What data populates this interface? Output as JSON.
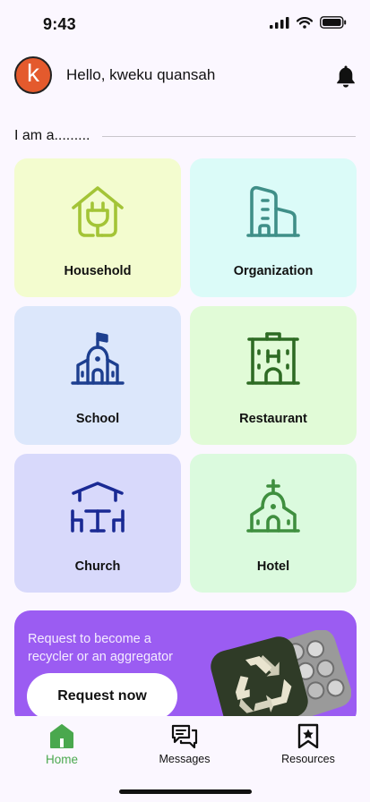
{
  "status_bar": {
    "time": "9:43"
  },
  "header": {
    "avatar_letter": "k",
    "greeting": "Hello, kweku quansah"
  },
  "section": {
    "label": "I am a........."
  },
  "categories": [
    {
      "label": "Household",
      "icon": "house-plug-icon",
      "bg": "#f3fccf",
      "color": "#a3c436"
    },
    {
      "label": "Organization",
      "icon": "office-building-icon",
      "bg": "#dbfbf8",
      "color": "#3f8f88"
    },
    {
      "label": "School",
      "icon": "school-building-icon",
      "bg": "#dce7fb",
      "color": "#1d3f8f"
    },
    {
      "label": "Restaurant",
      "icon": "hotel-building-icon",
      "bg": "#e1fbd7",
      "color": "#2e6b24"
    },
    {
      "label": "Church",
      "icon": "church-pavilion-icon",
      "bg": "#d8d9fb",
      "color": "#1a2a94"
    },
    {
      "label": "Hotel",
      "icon": "chapel-icon",
      "bg": "#dbfade",
      "color": "#3f8f3f"
    }
  ],
  "promo": {
    "text": "Request to become a recycler or an aggregator",
    "button_label": "Request now"
  },
  "nav": [
    {
      "label": "Home",
      "icon": "home-icon",
      "active": true
    },
    {
      "label": "Messages",
      "icon": "messages-icon",
      "active": false
    },
    {
      "label": "Resources",
      "icon": "bookmark-star-icon",
      "active": false
    }
  ],
  "colors": {
    "accent_green": "#4aa84e",
    "promo_purple": "#9b5cf2",
    "avatar_orange": "#e45a2d"
  }
}
